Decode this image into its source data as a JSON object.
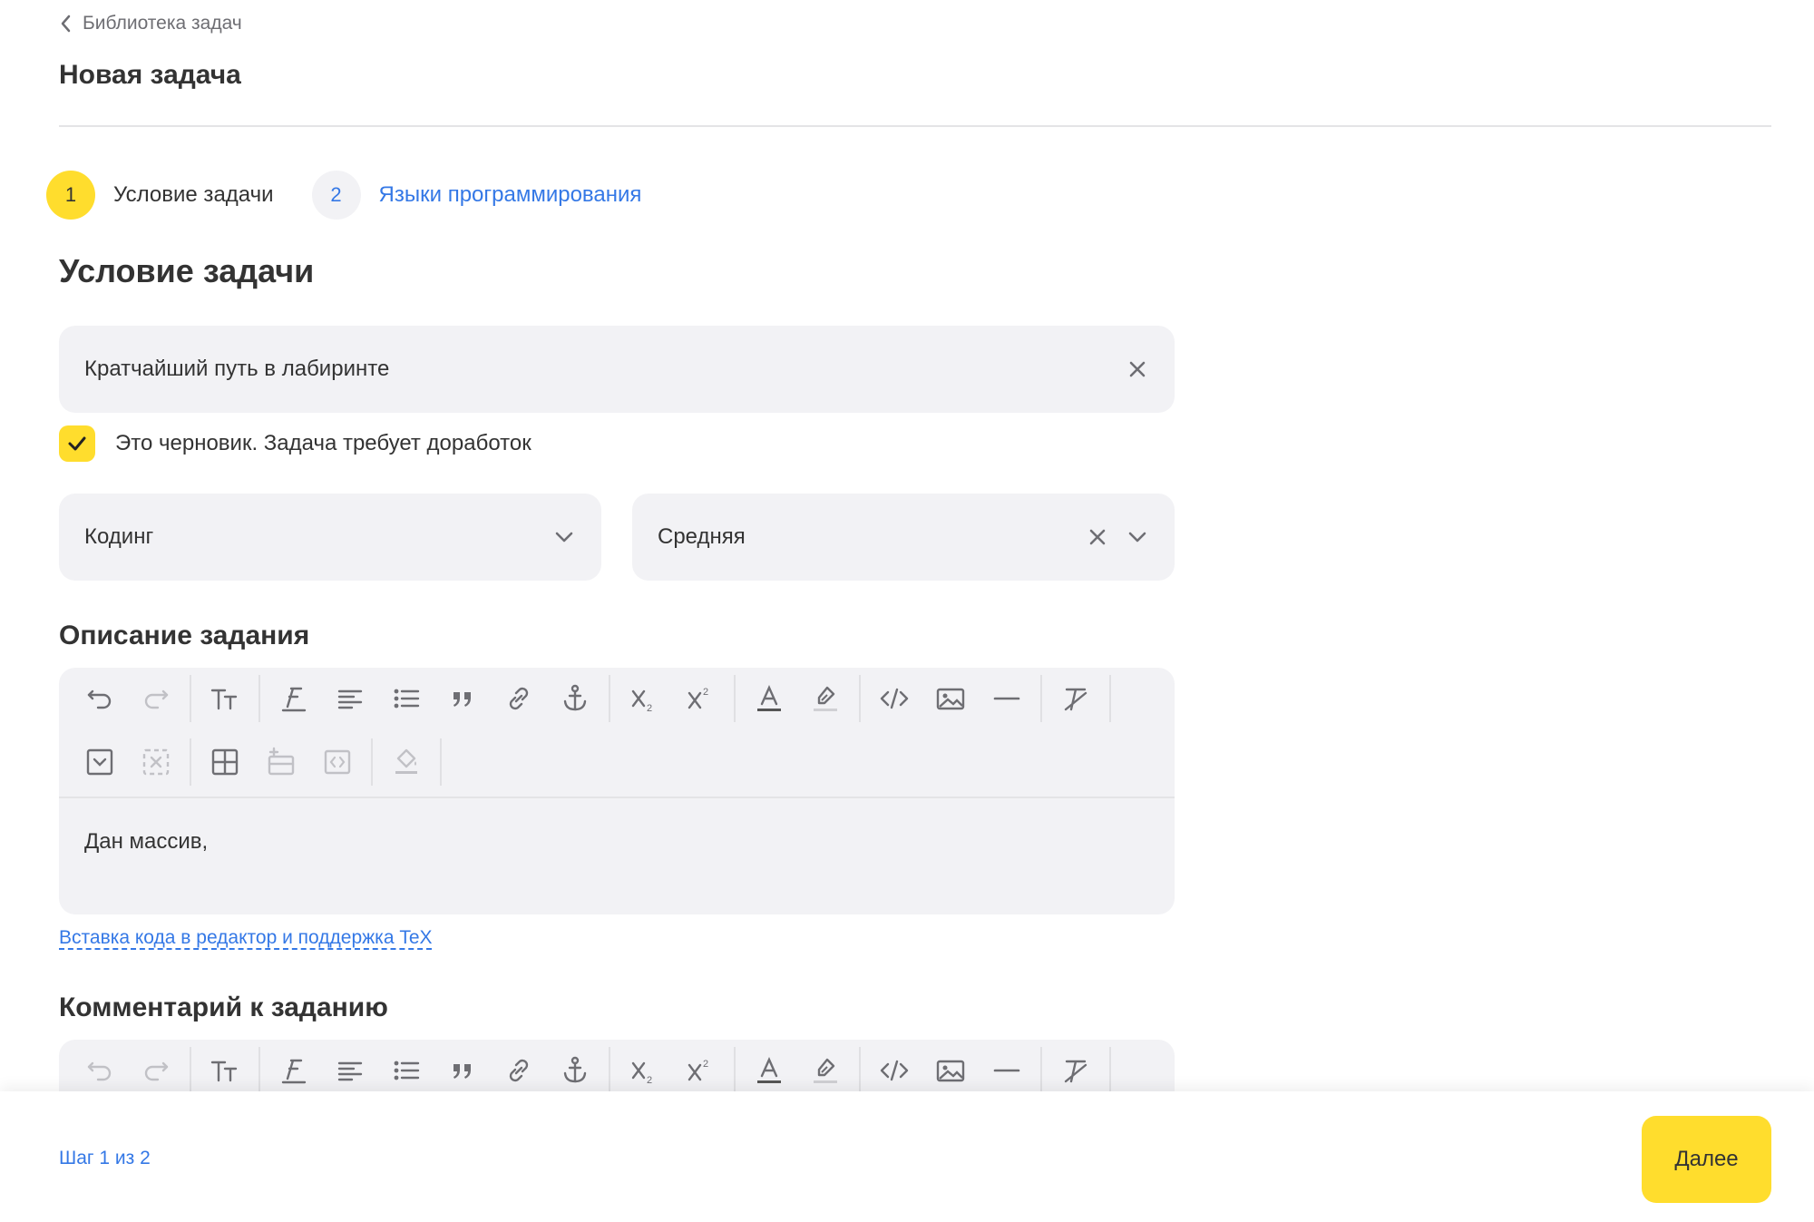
{
  "breadcrumb": {
    "label": "Библиотека задач"
  },
  "page": {
    "title": "Новая задача"
  },
  "stepper": {
    "steps": [
      {
        "number": "1",
        "label": "Условие задачи",
        "active": true
      },
      {
        "number": "2",
        "label": "Языки программирования",
        "active": false
      }
    ]
  },
  "main": {
    "heading": "Условие задачи",
    "task_title": {
      "value": "Кратчайший путь в лабиринте"
    },
    "draft_checkbox": {
      "label": "Это черновик. Задача требует доработок",
      "checked": true
    },
    "category_select": {
      "value": "Кодинг"
    },
    "difficulty_select": {
      "value": "Средняя"
    }
  },
  "description": {
    "heading": "Описание задания",
    "content": "Дан массив,",
    "help_link": "Вставка кода в редактор и поддержка TeX"
  },
  "comment": {
    "heading": "Комментарий к заданию"
  },
  "footer": {
    "step_counter": "Шаг 1 из 2",
    "next_label": "Далее"
  },
  "colors": {
    "accent": "#ffdd2d",
    "link": "#3478e6",
    "field_bg": "#f2f2f5",
    "text": "#333333"
  },
  "icons": {
    "toolbar_row1": [
      "undo-icon",
      "redo-icon",
      "font-size-icon",
      "font-style-icon",
      "align-icon",
      "bulleted-list-icon",
      "blockquote-icon",
      "link-icon",
      "anchor-icon",
      "subscript-icon",
      "superscript-icon",
      "text-color-icon",
      "highlight-icon",
      "code-icon",
      "image-icon",
      "horizontal-rule-icon",
      "clear-format-icon"
    ],
    "toolbar_row2": [
      "collapsible-icon",
      "remove-collapsible-icon",
      "table-icon",
      "insert-row-icon",
      "code-block-icon",
      "fill-color-icon"
    ]
  }
}
